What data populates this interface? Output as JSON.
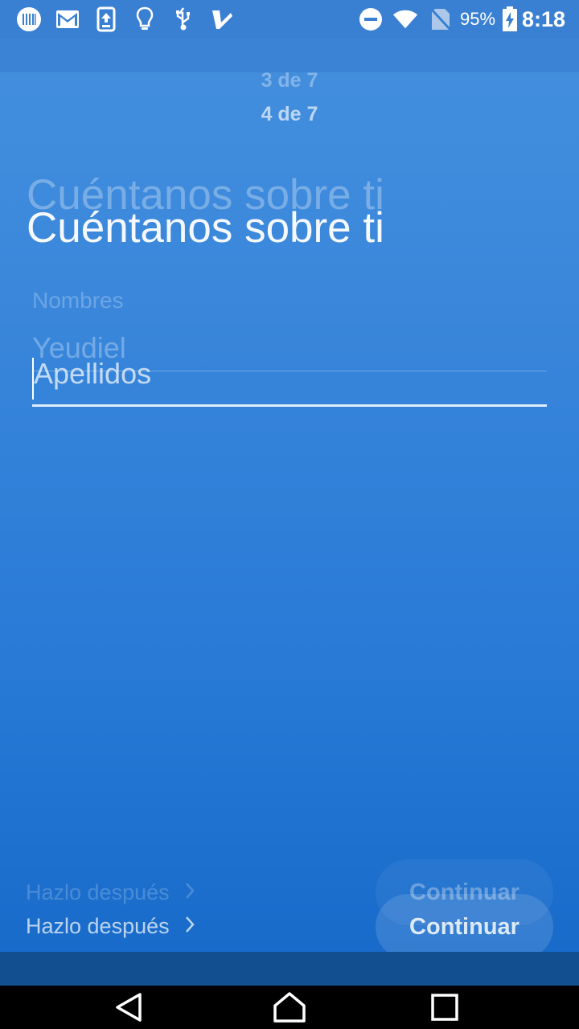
{
  "status_bar": {
    "battery_percent": "95%",
    "time": "8:18",
    "icons": [
      "barcode-app-icon",
      "gmail-icon",
      "upload-icon",
      "lightbulb-icon",
      "usb-icon",
      "checkmark-app-icon",
      "do-not-disturb-icon",
      "wifi-icon",
      "no-sim-icon",
      "battery-charging-icon"
    ]
  },
  "step": {
    "previous": "3 de 7",
    "current": "4 de 7"
  },
  "title": {
    "ghost": "Cuéntanos sobre ti",
    "main": "Cuéntanos sobre ti"
  },
  "ghost_field": {
    "label": "Nombres",
    "value": "Yeudiel"
  },
  "field": {
    "placeholder": "Apellidos",
    "value": ""
  },
  "actions": {
    "later_ghost": "Hazlo después",
    "later": "Hazlo después",
    "continue_ghost": "Continuar",
    "continue": "Continuar"
  },
  "nav_bar": {
    "icons": [
      "back-icon",
      "home-icon",
      "recents-icon"
    ]
  },
  "colors": {
    "background_top": "#4590de",
    "background_bottom": "#1669c8",
    "status_bar": "#3a80d2"
  }
}
